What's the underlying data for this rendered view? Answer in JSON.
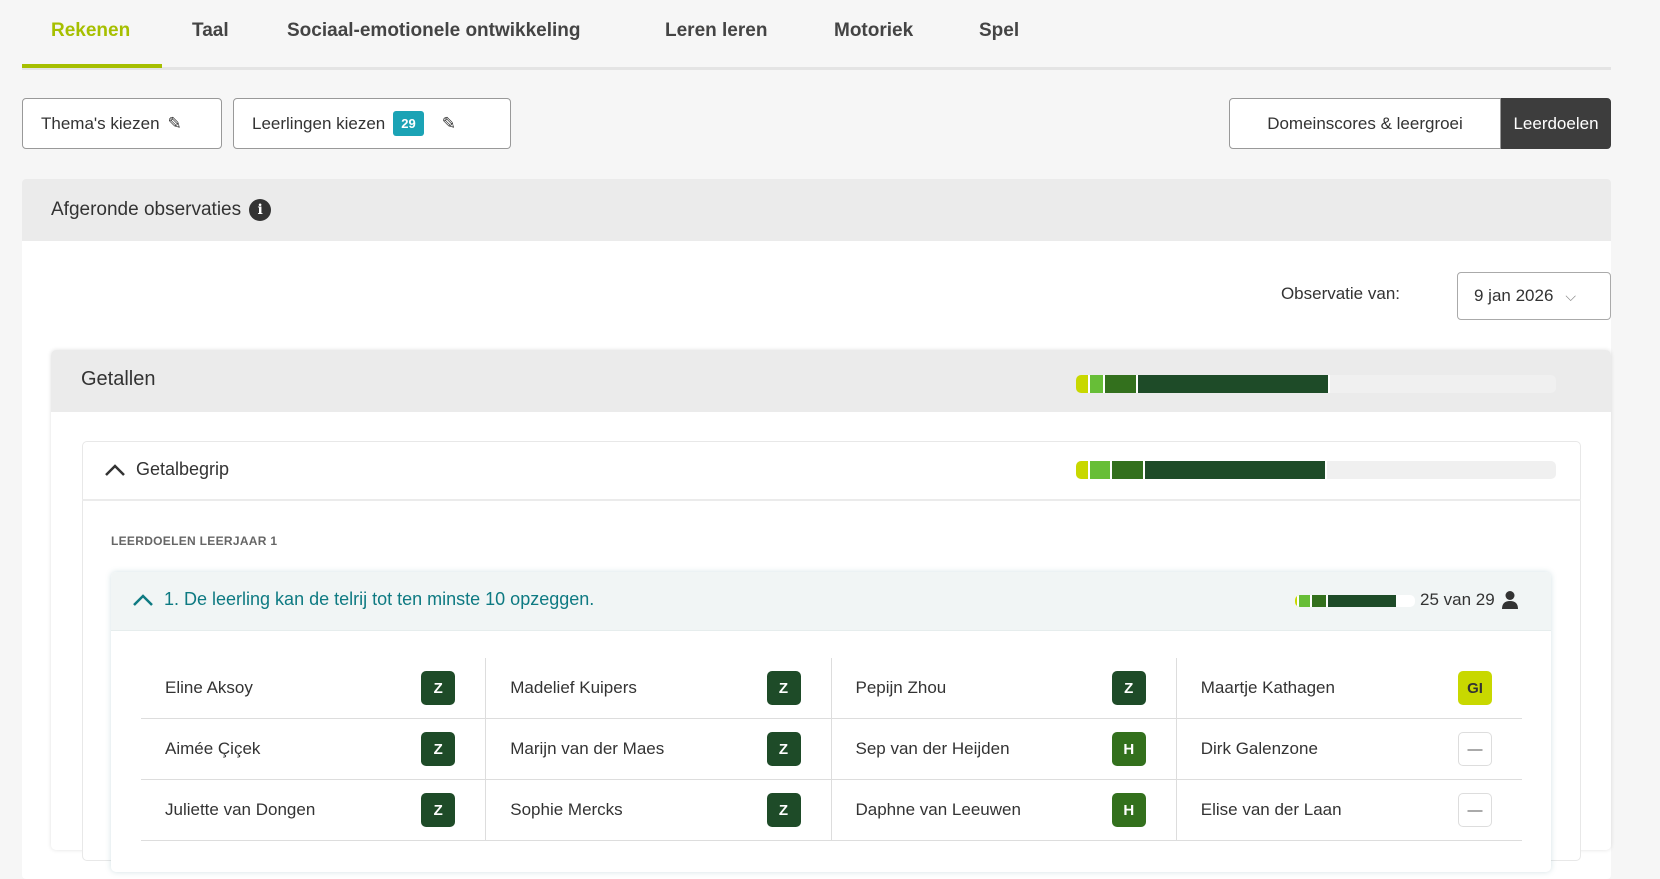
{
  "tabs": [
    {
      "label": "Rekenen",
      "active": true
    },
    {
      "label": "Taal"
    },
    {
      "label": "Sociaal-emotionele ontwikkeling"
    },
    {
      "label": "Leren leren"
    },
    {
      "label": "Motoriek"
    },
    {
      "label": "Spel"
    }
  ],
  "toolbar": {
    "themes_label": "Thema's kiezen",
    "students_label": "Leerlingen kiezen",
    "students_count": "29",
    "view_domain": "Domeinscores & leergroei",
    "view_goals": "Leerdoelen"
  },
  "panel": {
    "title": "Afgeronde observaties",
    "obs_label": "Observatie van:",
    "obs_date": "9 jan 2026"
  },
  "colors": {
    "GI": "#c8d800",
    "light": "#67be37",
    "H": "#33701d",
    "Z": "#1e4b28",
    "empty": "#f0f0f0"
  },
  "domain": {
    "title": "Getallen",
    "progress": [
      0.03,
      0.03,
      0.07,
      0.4
    ]
  },
  "subdomain": {
    "title": "Getalbegrip",
    "progress": [
      0.03,
      0.044,
      0.07,
      0.38
    ]
  },
  "section_label": "LEERDOELEN LEERJAAR 1",
  "goal": {
    "title": "1. De leerling kan de telrij tot ten minste 10 opzeggen.",
    "progress": [
      1,
      3,
      4,
      17
    ],
    "total": 29,
    "count_text": "25 van 29"
  },
  "students": [
    {
      "name": "Eline Aksoy",
      "score": "Z"
    },
    {
      "name": "Madelief Kuipers",
      "score": "Z"
    },
    {
      "name": "Pepijn Zhou",
      "score": "Z"
    },
    {
      "name": "Maartje Kathagen",
      "score": "GI"
    },
    {
      "name": "Aimée Çiçek",
      "score": "Z"
    },
    {
      "name": "Marijn van der Maes",
      "score": "Z"
    },
    {
      "name": "Sep van der Heijden",
      "score": "H"
    },
    {
      "name": "Dirk Galenzone",
      "score": "—"
    },
    {
      "name": "Juliette van Dongen",
      "score": "Z"
    },
    {
      "name": "Sophie Mercks",
      "score": "Z"
    },
    {
      "name": "Daphne van Leeuwen",
      "score": "H"
    },
    {
      "name": "Elise van der Laan",
      "score": "—"
    }
  ]
}
